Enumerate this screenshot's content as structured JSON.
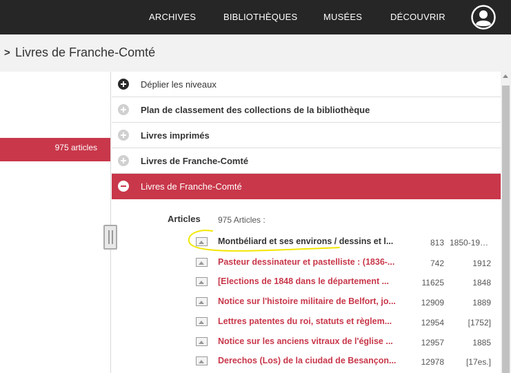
{
  "nav": {
    "items": [
      "ARCHIVES",
      "BIBLIOTHÈQUES",
      "MUSÉES",
      "DÉCOUVRIR"
    ]
  },
  "breadcrumb": {
    "title": "Livres de Franche-Comté"
  },
  "left": {
    "count_label": "975 articles"
  },
  "tree": {
    "expand_label": "Déplier les niveaux",
    "levels": [
      "Plan de classement des collections de la bibliothèque",
      "Livres imprimés",
      "Livres de Franche-Comté",
      "Livres de Franche-Comté"
    ]
  },
  "articles": {
    "label": "Articles",
    "count": "975 Articles :",
    "items": [
      {
        "title": "Montbéliard et ses environs / dessins et l...",
        "num": "813",
        "date": "1850-190..."
      },
      {
        "title": "Pasteur dessinateur et pastelliste : (1836-...",
        "num": "742",
        "date": "1912"
      },
      {
        "title": "[Elections de 1848 dans le département ...",
        "num": "11625",
        "date": "1848"
      },
      {
        "title": "Notice sur l'histoire militaire de Belfort, jo...",
        "num": "12909",
        "date": "1889"
      },
      {
        "title": "Lettres patentes du roi, statuts et règlem...",
        "num": "12954",
        "date": "[1752]"
      },
      {
        "title": "Notice sur les anciens vitraux de l'église ...",
        "num": "12957",
        "date": "1885"
      },
      {
        "title": "Derechos (Los) de la ciudad de Besançon...",
        "num": "12978",
        "date": "[17es.]"
      }
    ]
  },
  "colors": {
    "accent": "#c8374a",
    "topbar": "#262626",
    "highlight": "#f2e600"
  }
}
